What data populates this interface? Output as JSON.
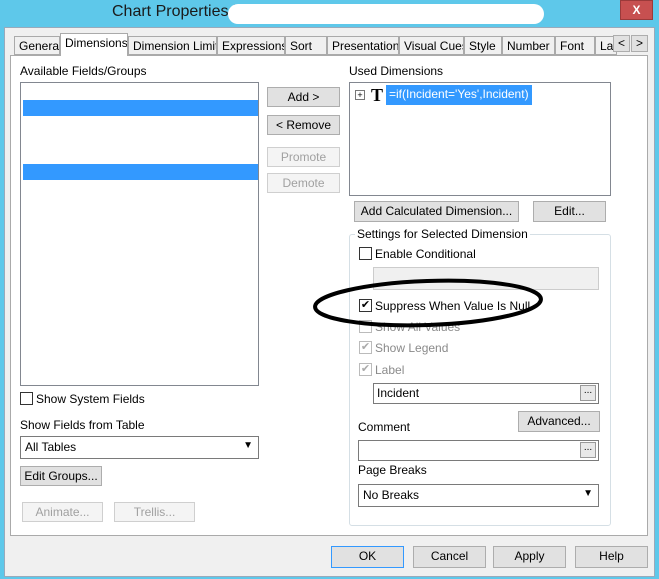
{
  "window": {
    "title": "Chart Properties [",
    "close": "X"
  },
  "tabs": [
    "General",
    "Dimensions",
    "Dimension Limits",
    "Expressions",
    "Sort",
    "Presentation",
    "Visual Cues",
    "Style",
    "Number",
    "Font",
    "La"
  ],
  "tab_scroll": {
    "left": "<",
    "right": ">"
  },
  "available": {
    "label": "Available Fields/Groups"
  },
  "buttons": {
    "add": "Add >",
    "remove": "< Remove",
    "promote": "Promote",
    "demote": "Demote",
    "add_calc": "Add Calculated Dimension...",
    "edit": "Edit...",
    "advanced": "Advanced...",
    "edit_groups": "Edit Groups...",
    "animate": "Animate...",
    "trellis": "Trellis...",
    "ok": "OK",
    "cancel": "Cancel",
    "apply": "Apply",
    "help": "Help",
    "dots": "..."
  },
  "used": {
    "label": "Used Dimensions",
    "items": [
      {
        "icon": "T",
        "text": "=if(Incident='Yes',Incident)"
      }
    ]
  },
  "settings": {
    "legend": "Settings for Selected Dimension",
    "enable_conditional": "Enable Conditional",
    "suppress_null": "Suppress When Value Is Null",
    "show_all": "Show All Values",
    "show_legend": "Show Legend",
    "label": "Label",
    "label_value": "Incident",
    "comment": "Comment",
    "comment_value": "",
    "page_breaks": "Page Breaks",
    "page_breaks_value": "No Breaks"
  },
  "left": {
    "show_system": "Show System Fields",
    "show_from_table": "Show Fields from Table",
    "table_value": "All Tables"
  }
}
